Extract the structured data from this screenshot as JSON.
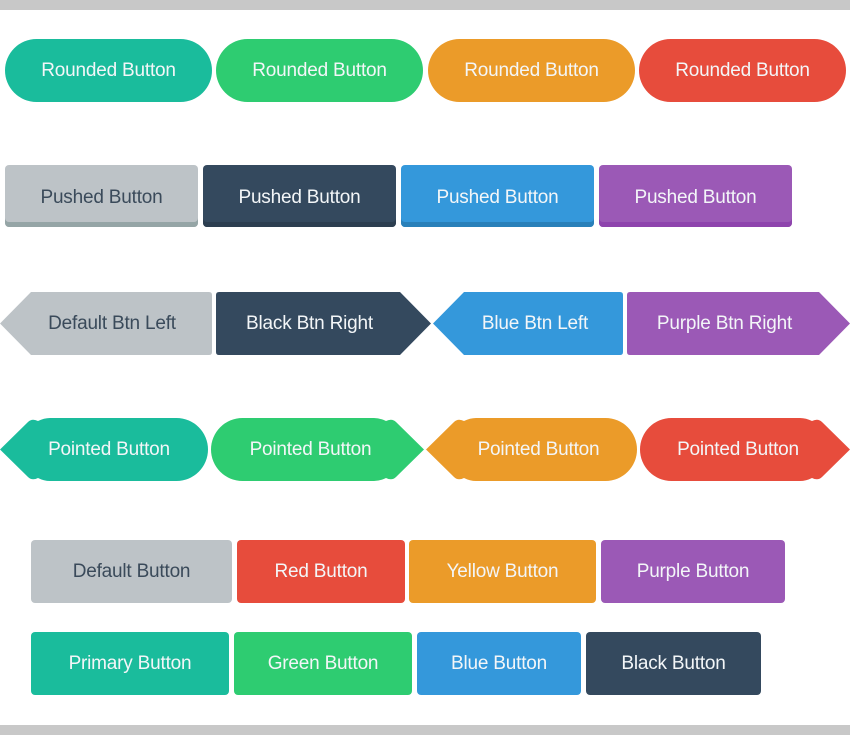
{
  "colors": {
    "turquoise": "#1abc9c",
    "green": "#2ecc71",
    "orange": "#eb9b29",
    "red": "#e74c3c",
    "gray": "#bdc3c7",
    "gray_shadow": "#95a5a6",
    "navy": "#34495e",
    "navy_shadow": "#2c3e50",
    "blue": "#3498db",
    "blue_shadow": "#2980b9",
    "purple": "#9b59b6",
    "purple_shadow": "#8e44ad",
    "frame": "#c8c8c8"
  },
  "rows": {
    "rounded": [
      {
        "label": "Rounded Button",
        "color": "turquoise"
      },
      {
        "label": "Rounded Button",
        "color": "green"
      },
      {
        "label": "Rounded Button",
        "color": "orange"
      },
      {
        "label": "Rounded Button",
        "color": "red"
      }
    ],
    "pushed": [
      {
        "label": "Pushed Button",
        "color": "gray"
      },
      {
        "label": "Pushed Button",
        "color": "navy"
      },
      {
        "label": "Pushed Button",
        "color": "blue"
      },
      {
        "label": "Pushed Button",
        "color": "purple"
      }
    ],
    "arrow": [
      {
        "label": "Default Btn Left",
        "color": "gray",
        "direction": "left"
      },
      {
        "label": "Black Btn Right",
        "color": "navy",
        "direction": "right"
      },
      {
        "label": "Blue Btn Left",
        "color": "blue",
        "direction": "left"
      },
      {
        "label": "Purple Btn Right",
        "color": "purple",
        "direction": "right"
      }
    ],
    "pointed": [
      {
        "label": "Pointed Button",
        "color": "turquoise",
        "direction": "left"
      },
      {
        "label": "Pointed Button",
        "color": "green",
        "direction": "right"
      },
      {
        "label": "Pointed Button",
        "color": "orange",
        "direction": "left"
      },
      {
        "label": "Pointed Button",
        "color": "red",
        "direction": "right"
      }
    ],
    "flat1": [
      {
        "label": "Default Button",
        "color": "gray"
      },
      {
        "label": "Red Button",
        "color": "red"
      },
      {
        "label": "Yellow Button",
        "color": "orange"
      },
      {
        "label": "Purple Button",
        "color": "purple"
      }
    ],
    "flat2": [
      {
        "label": "Primary Button",
        "color": "turquoise"
      },
      {
        "label": "Green Button",
        "color": "green"
      },
      {
        "label": "Blue Button",
        "color": "blue"
      },
      {
        "label": "Black Button",
        "color": "navy"
      }
    ]
  }
}
